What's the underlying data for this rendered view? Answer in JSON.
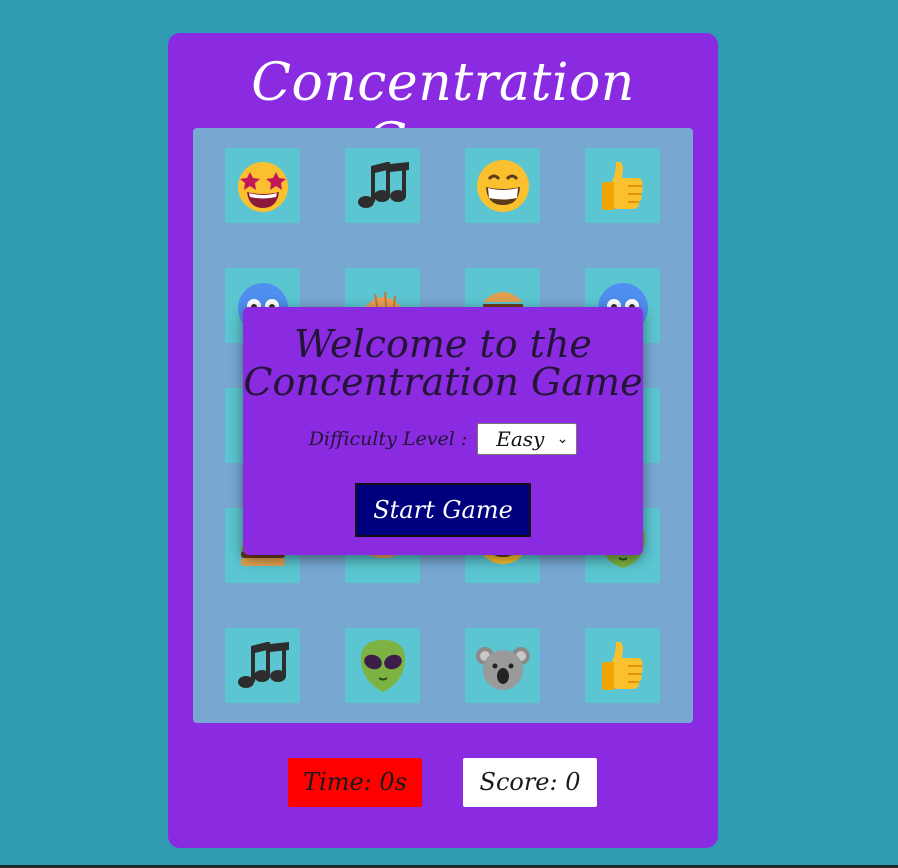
{
  "game": {
    "title": "Concentration Game"
  },
  "board": {
    "cards": [
      {
        "icon": "star-struck-face-icon"
      },
      {
        "icon": "music-notes-icon"
      },
      {
        "icon": "grinning-face-icon"
      },
      {
        "icon": "thumbs-up-icon"
      },
      {
        "icon": "cold-face-icon"
      },
      {
        "icon": "croissant-icon"
      },
      {
        "icon": "burger-icon"
      },
      {
        "icon": "cold-face-icon"
      },
      {
        "icon": "hidden-card"
      },
      {
        "icon": "hidden-card"
      },
      {
        "icon": "hidden-card"
      },
      {
        "icon": "hidden-card"
      },
      {
        "icon": "burger-icon"
      },
      {
        "icon": "croissant-icon"
      },
      {
        "icon": "grinning-face-icon"
      },
      {
        "icon": "alien-icon"
      },
      {
        "icon": "music-notes-icon"
      },
      {
        "icon": "alien-icon"
      },
      {
        "icon": "koala-icon"
      },
      {
        "icon": "thumbs-up-icon"
      }
    ]
  },
  "modal": {
    "title": "Welcome to the Concentration Game",
    "difficulty_label": "Difficulty Level :",
    "difficulty_value": "Easy",
    "start_label": "Start Game"
  },
  "stats": {
    "time_label": "Time: 0s",
    "score_label": "Score: 0"
  },
  "colors": {
    "background": "#2e9bb2",
    "panel": "#8a2be2",
    "board": "#78a8d2",
    "card": "#5bc6d1",
    "start_button": "#00007f",
    "time_box": "#ff0000",
    "score_box": "#ffffff"
  }
}
